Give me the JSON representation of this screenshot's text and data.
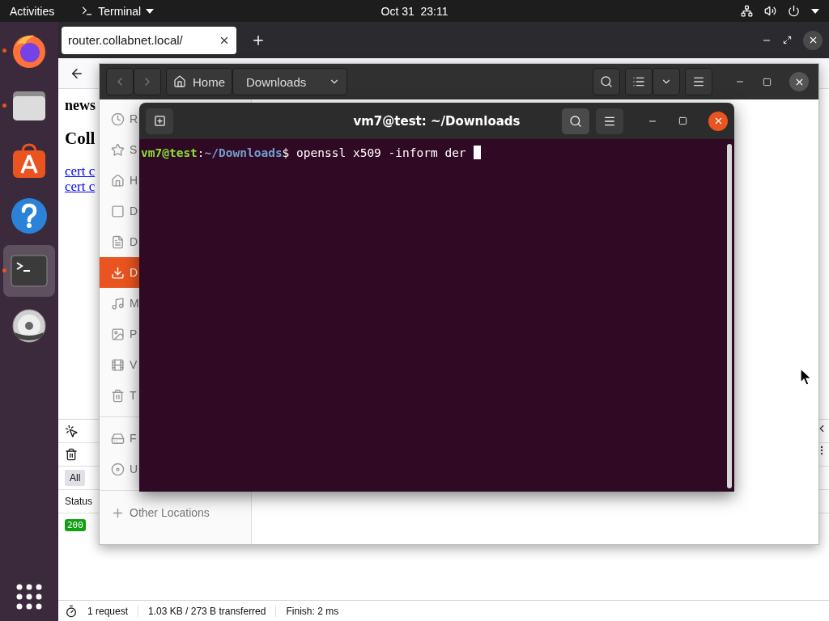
{
  "top_bar": {
    "activities": "Activities",
    "app_menu": "Terminal",
    "clock": "Oct 31  23:11"
  },
  "dock": {
    "items": [
      {
        "kind": "browser",
        "running": true,
        "selected": false
      },
      {
        "kind": "files",
        "running": true,
        "selected": false
      },
      {
        "kind": "software",
        "running": false,
        "selected": false
      },
      {
        "kind": "help",
        "running": false,
        "selected": false
      },
      {
        "kind": "terminal",
        "running": true,
        "selected": true
      },
      {
        "kind": "disc",
        "running": false,
        "selected": false
      }
    ]
  },
  "browser": {
    "tab": {
      "title": "router.collabnet.local/"
    },
    "page": {
      "heading_1": "news",
      "heading_2": "Coll",
      "links": [
        "cert c",
        "cert c"
      ]
    },
    "devtools": {
      "filters": [
        {
          "label": "All",
          "selected": true
        }
      ],
      "columns": [
        "Status"
      ],
      "rows": [
        {
          "status": "200"
        }
      ]
    },
    "status_bar": [
      "1 request",
      "1.03 KB / 273 B transferred",
      "Finish: 2 ms"
    ]
  },
  "files": {
    "path": [
      "Home",
      "Downloads"
    ],
    "places": [
      {
        "kind": "recent",
        "label": "R",
        "selected": false
      },
      {
        "kind": "starred",
        "label": "S",
        "selected": false
      },
      {
        "kind": "home",
        "label": "H",
        "selected": false
      },
      {
        "kind": "desktop",
        "label": "D",
        "selected": false
      },
      {
        "kind": "documents",
        "label": "D",
        "selected": false
      },
      {
        "kind": "downloads",
        "label": "D",
        "selected": true
      },
      {
        "kind": "music",
        "label": "M",
        "selected": false
      },
      {
        "kind": "pictures",
        "label": "P",
        "selected": false
      },
      {
        "kind": "videos",
        "label": "V",
        "selected": false
      },
      {
        "kind": "trash",
        "label": "T",
        "selected": false
      }
    ],
    "devices": [
      {
        "kind": "drive",
        "label": "F",
        "selected": false
      },
      {
        "kind": "disc",
        "label": "U",
        "selected": false
      }
    ],
    "other_locations": "Other Locations"
  },
  "terminal": {
    "title": "vm7@test: ~/Downloads",
    "prompt_user": "vm7@test",
    "prompt_sep": ":",
    "prompt_path": "~/Downloads",
    "prompt_end": "$",
    "command": "openssl x509 -inform der"
  }
}
